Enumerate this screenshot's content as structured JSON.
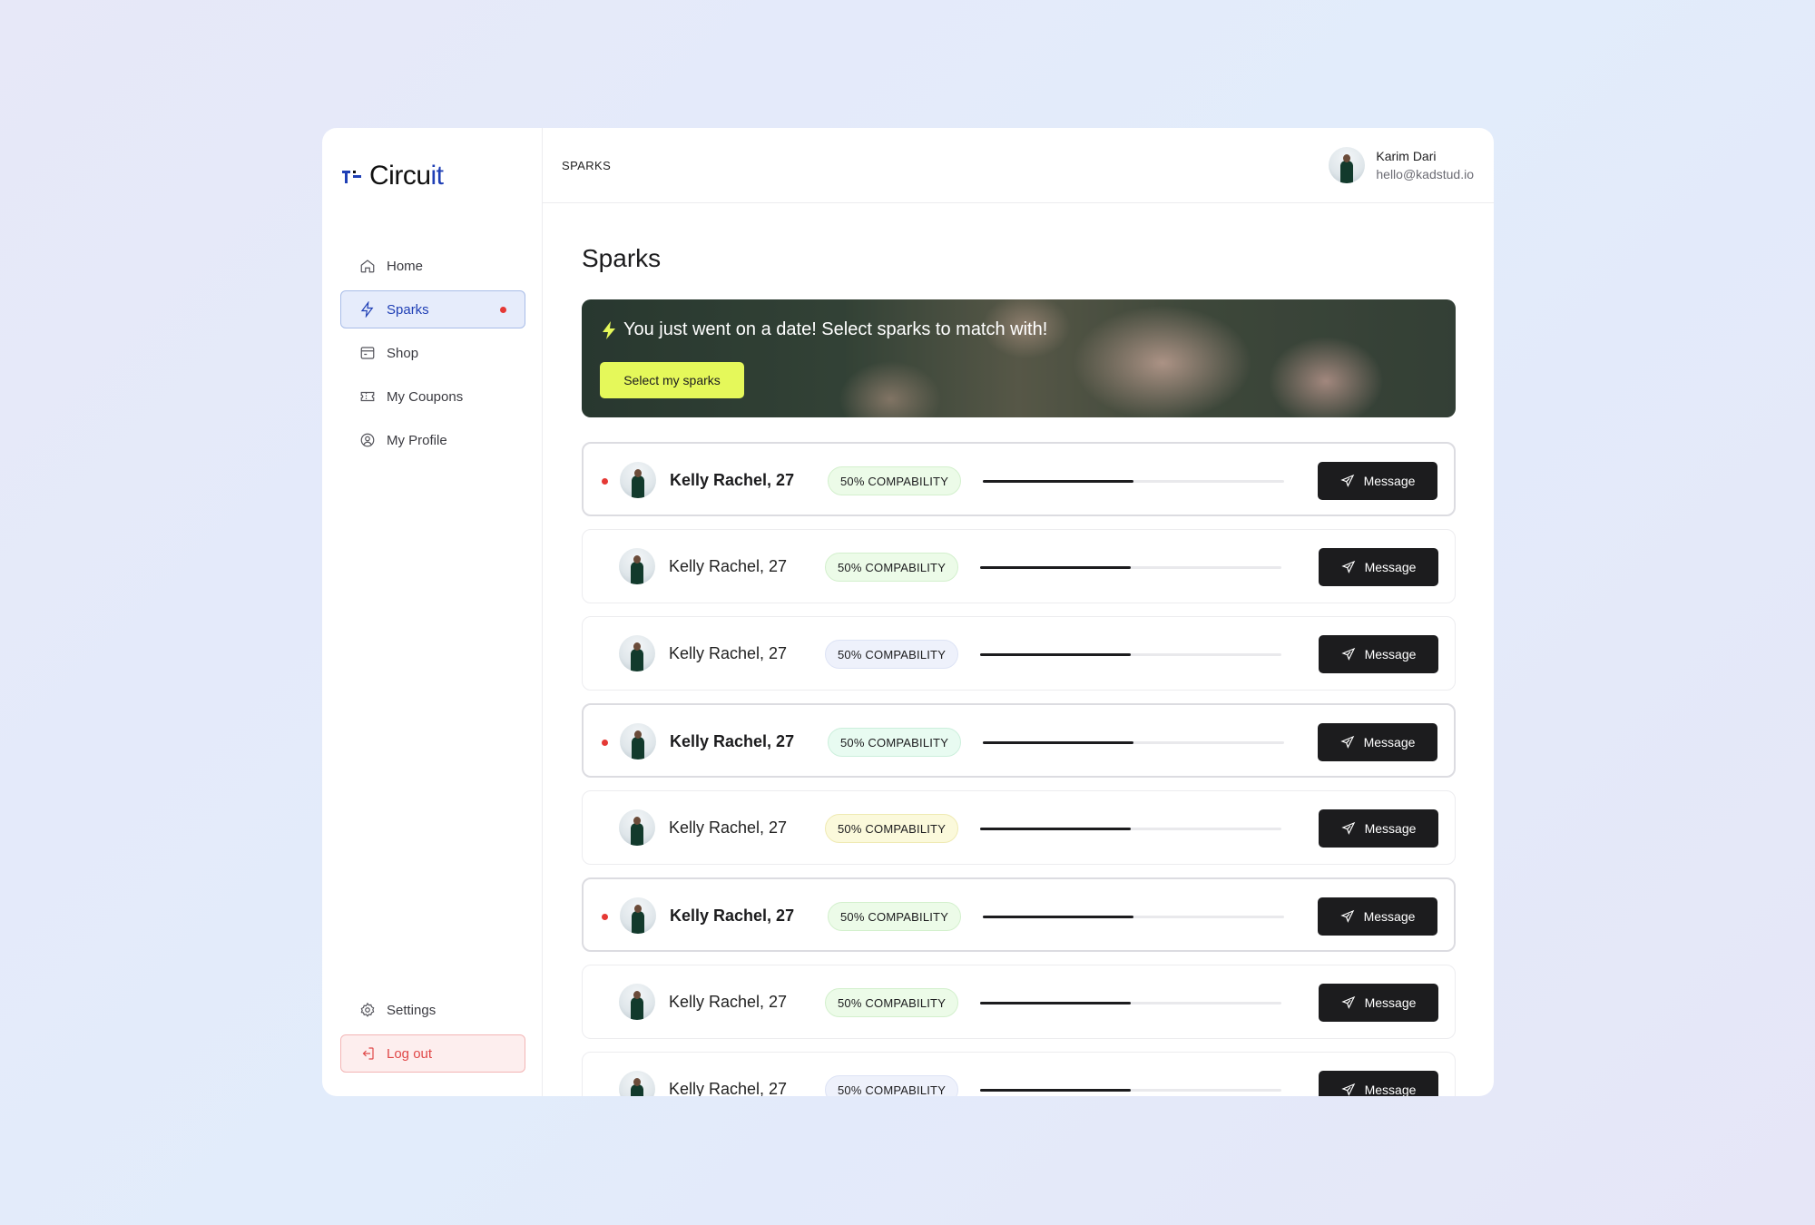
{
  "brand": {
    "name_main": "Circu",
    "name_accent": "it"
  },
  "sidebar": {
    "items": [
      {
        "label": "Home",
        "icon": "home-icon"
      },
      {
        "label": "Sparks",
        "icon": "bolt-icon",
        "active": true,
        "has_dot": true
      },
      {
        "label": "Shop",
        "icon": "shop-icon"
      },
      {
        "label": "My Coupons",
        "icon": "coupon-icon"
      },
      {
        "label": "My Profile",
        "icon": "profile-icon"
      }
    ],
    "settings_label": "Settings",
    "logout_label": "Log out"
  },
  "header": {
    "breadcrumb": "SPARKS",
    "user_name": "Karim Dari",
    "user_email": "hello@kadstud.io"
  },
  "page": {
    "title": "Sparks"
  },
  "banner": {
    "text": "You just went on a date! Select sparks to match with!",
    "button_label": "Select my sparks"
  },
  "sparks": [
    {
      "name": "Kelly Rachel, 27",
      "compat_label": "50% COMPABILITY",
      "compat_value": 0.5,
      "unread": true,
      "badge_color": "green"
    },
    {
      "name": "Kelly Rachel, 27",
      "compat_label": "50% COMPABILITY",
      "compat_value": 0.5,
      "unread": false,
      "badge_color": "green"
    },
    {
      "name": "Kelly Rachel, 27",
      "compat_label": "50% COMPABILITY",
      "compat_value": 0.5,
      "unread": false,
      "badge_color": "blue"
    },
    {
      "name": "Kelly Rachel, 27",
      "compat_label": "50% COMPABILITY",
      "compat_value": 0.5,
      "unread": true,
      "badge_color": "mint"
    },
    {
      "name": "Kelly Rachel, 27",
      "compat_label": "50% COMPABILITY",
      "compat_value": 0.5,
      "unread": false,
      "badge_color": "yellow"
    },
    {
      "name": "Kelly Rachel, 27",
      "compat_label": "50% COMPABILITY",
      "compat_value": 0.5,
      "unread": true,
      "badge_color": "green"
    },
    {
      "name": "Kelly Rachel, 27",
      "compat_label": "50% COMPABILITY",
      "compat_value": 0.5,
      "unread": false,
      "badge_color": "green"
    },
    {
      "name": "Kelly Rachel, 27",
      "compat_label": "50% COMPABILITY",
      "compat_value": 0.5,
      "unread": false,
      "badge_color": "blue"
    }
  ],
  "message_label": "Message",
  "colors": {
    "accent": "#1f3fb5",
    "cta": "#e5f85a",
    "dark": "#1c1c1e",
    "alert": "#e53935"
  }
}
